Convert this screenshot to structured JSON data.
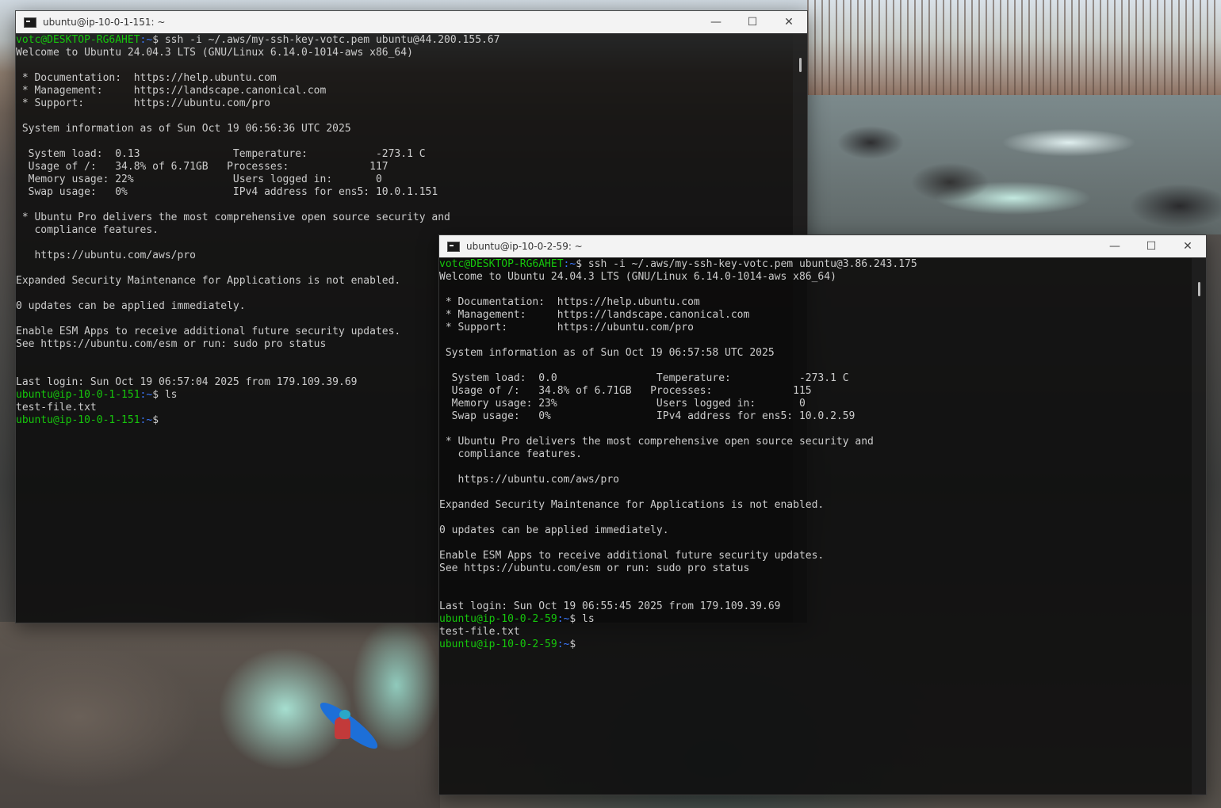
{
  "windows": [
    {
      "title": "ubuntu@ip-10-0-1-151: ~",
      "controls": {
        "minimize": "—",
        "maximize": "☐",
        "close": "✕"
      },
      "lines": [
        {
          "user": "votc@DESKTOP-RG6AHET",
          "path": ":~",
          "rest": "$ ssh -i ~/.aws/my-ssh-key-votc.pem ubuntu@44.200.155.67"
        },
        {
          "text": "Welcome to Ubuntu 24.04.3 LTS (GNU/Linux 6.14.0-1014-aws x86_64)"
        },
        {
          "text": ""
        },
        {
          "text": " * Documentation:  https://help.ubuntu.com"
        },
        {
          "text": " * Management:     https://landscape.canonical.com"
        },
        {
          "text": " * Support:        https://ubuntu.com/pro"
        },
        {
          "text": ""
        },
        {
          "text": " System information as of Sun Oct 19 06:56:36 UTC 2025"
        },
        {
          "text": ""
        },
        {
          "text": "  System load:  0.13               Temperature:           -273.1 C"
        },
        {
          "text": "  Usage of /:   34.8% of 6.71GB   Processes:             117"
        },
        {
          "text": "  Memory usage: 22%                Users logged in:       0"
        },
        {
          "text": "  Swap usage:   0%                 IPv4 address for ens5: 10.0.1.151"
        },
        {
          "text": ""
        },
        {
          "text": " * Ubuntu Pro delivers the most comprehensive open source security and"
        },
        {
          "text": "   compliance features."
        },
        {
          "text": ""
        },
        {
          "text": "   https://ubuntu.com/aws/pro"
        },
        {
          "text": ""
        },
        {
          "text": "Expanded Security Maintenance for Applications is not enabled."
        },
        {
          "text": ""
        },
        {
          "text": "0 updates can be applied immediately."
        },
        {
          "text": ""
        },
        {
          "text": "Enable ESM Apps to receive additional future security updates."
        },
        {
          "text": "See https://ubuntu.com/esm or run: sudo pro status"
        },
        {
          "text": ""
        },
        {
          "text": ""
        },
        {
          "text": "Last login: Sun Oct 19 06:57:04 2025 from 179.109.39.69"
        },
        {
          "user": "ubuntu@ip-10-0-1-151",
          "path": ":~",
          "rest": "$ ls"
        },
        {
          "text": "test-file.txt"
        },
        {
          "user": "ubuntu@ip-10-0-1-151",
          "path": ":~",
          "rest": "$"
        }
      ]
    },
    {
      "title": "ubuntu@ip-10-0-2-59: ~",
      "controls": {
        "minimize": "—",
        "maximize": "☐",
        "close": "✕"
      },
      "lines": [
        {
          "user": "votc@DESKTOP-RG6AHET",
          "path": ":~",
          "rest": "$ ssh -i ~/.aws/my-ssh-key-votc.pem ubuntu@3.86.243.175"
        },
        {
          "text": "Welcome to Ubuntu 24.04.3 LTS (GNU/Linux 6.14.0-1014-aws x86_64)"
        },
        {
          "text": ""
        },
        {
          "text": " * Documentation:  https://help.ubuntu.com"
        },
        {
          "text": " * Management:     https://landscape.canonical.com"
        },
        {
          "text": " * Support:        https://ubuntu.com/pro"
        },
        {
          "text": ""
        },
        {
          "text": " System information as of Sun Oct 19 06:57:58 UTC 2025"
        },
        {
          "text": ""
        },
        {
          "text": "  System load:  0.0                Temperature:           -273.1 C"
        },
        {
          "text": "  Usage of /:   34.8% of 6.71GB   Processes:             115"
        },
        {
          "text": "  Memory usage: 23%                Users logged in:       0"
        },
        {
          "text": "  Swap usage:   0%                 IPv4 address for ens5: 10.0.2.59"
        },
        {
          "text": ""
        },
        {
          "text": " * Ubuntu Pro delivers the most comprehensive open source security and"
        },
        {
          "text": "   compliance features."
        },
        {
          "text": ""
        },
        {
          "text": "   https://ubuntu.com/aws/pro"
        },
        {
          "text": ""
        },
        {
          "text": "Expanded Security Maintenance for Applications is not enabled."
        },
        {
          "text": ""
        },
        {
          "text": "0 updates can be applied immediately."
        },
        {
          "text": ""
        },
        {
          "text": "Enable ESM Apps to receive additional future security updates."
        },
        {
          "text": "See https://ubuntu.com/esm or run: sudo pro status"
        },
        {
          "text": ""
        },
        {
          "text": ""
        },
        {
          "text": "Last login: Sun Oct 19 06:55:45 2025 from 179.109.39.69"
        },
        {
          "user": "ubuntu@ip-10-0-2-59",
          "path": ":~",
          "rest": "$ ls"
        },
        {
          "text": "test-file.txt"
        },
        {
          "user": "ubuntu@ip-10-0-2-59",
          "path": ":~",
          "rest": "$"
        }
      ]
    }
  ],
  "colors": {
    "prompt_user": "#16c60c",
    "prompt_path": "#3b78ff",
    "terminal_text": "#cccccc",
    "terminal_bg": "#0c0c0c",
    "titlebar_bg": "#f3f3f3"
  },
  "icons": {
    "app": "terminal-icon",
    "minimize": "minimize-icon",
    "maximize": "maximize-icon",
    "close": "close-icon"
  }
}
